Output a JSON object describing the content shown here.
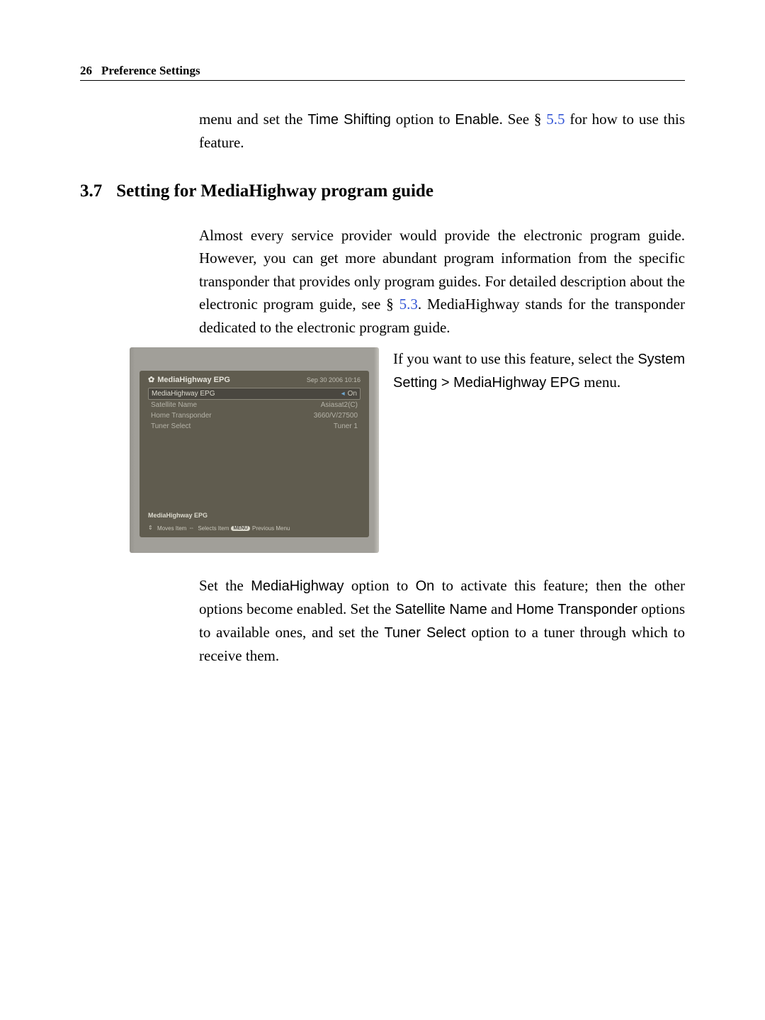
{
  "header": {
    "page_number": "26",
    "chapter_title": "Preference Settings"
  },
  "intro_text": {
    "part1": "menu and set the ",
    "time_shifting": "Time Shifting",
    "part2": " option to ",
    "enable": "Enable",
    "part3": ". See § ",
    "ref": "5.5",
    "part4": " for how to use this feature."
  },
  "section": {
    "number": "3.7",
    "title": "Setting for MediaHighway program guide"
  },
  "para1": {
    "part1": "Almost every service provider would provide the electronic program guide. However, you can get more abundant program information from the specific transponder that provides only program guides. For detailed description about the electronic program guide, see § ",
    "ref": "5.3",
    "part2": ". MediaHighway stands for the transponder dedicated to the electronic program guide."
  },
  "right_col": {
    "part1": "If you want to use this feature, select the ",
    "system_setting": "System Setting",
    "gt": " > ",
    "media_epg": "MediaHighway EPG",
    "part2": " menu."
  },
  "screenshot": {
    "title": "MediaHighway EPG",
    "date": "Sep 30 2006 10:16",
    "rows": [
      {
        "label": "MediaHighway EPG",
        "value": "On",
        "selected": true
      },
      {
        "label": "Satellite Name",
        "value": "Asiasat2(C)",
        "selected": false
      },
      {
        "label": "Home Transponder",
        "value": "3660/V/27500",
        "selected": false
      },
      {
        "label": "Tuner Select",
        "value": "Tuner 1",
        "selected": false
      }
    ],
    "footer_title": "MediaHighway EPG",
    "footer_hint": {
      "moves": "Moves Item",
      "selects": "Selects Item",
      "menu_badge": "MENU",
      "previous": "Previous Menu"
    }
  },
  "para2": {
    "part1": "Set the ",
    "mediahighway": "MediaHighway",
    "part2": " option to ",
    "on": "On",
    "part3": " to activate this feature; then the other options become enabled. Set the ",
    "sat_name": "Satellite Name",
    "part4": " and ",
    "home_trans": "Home Transponder",
    "part5": " options to available ones, and set the ",
    "tuner_select": "Tuner Select",
    "part6": " option to a tuner through which to receive them."
  }
}
